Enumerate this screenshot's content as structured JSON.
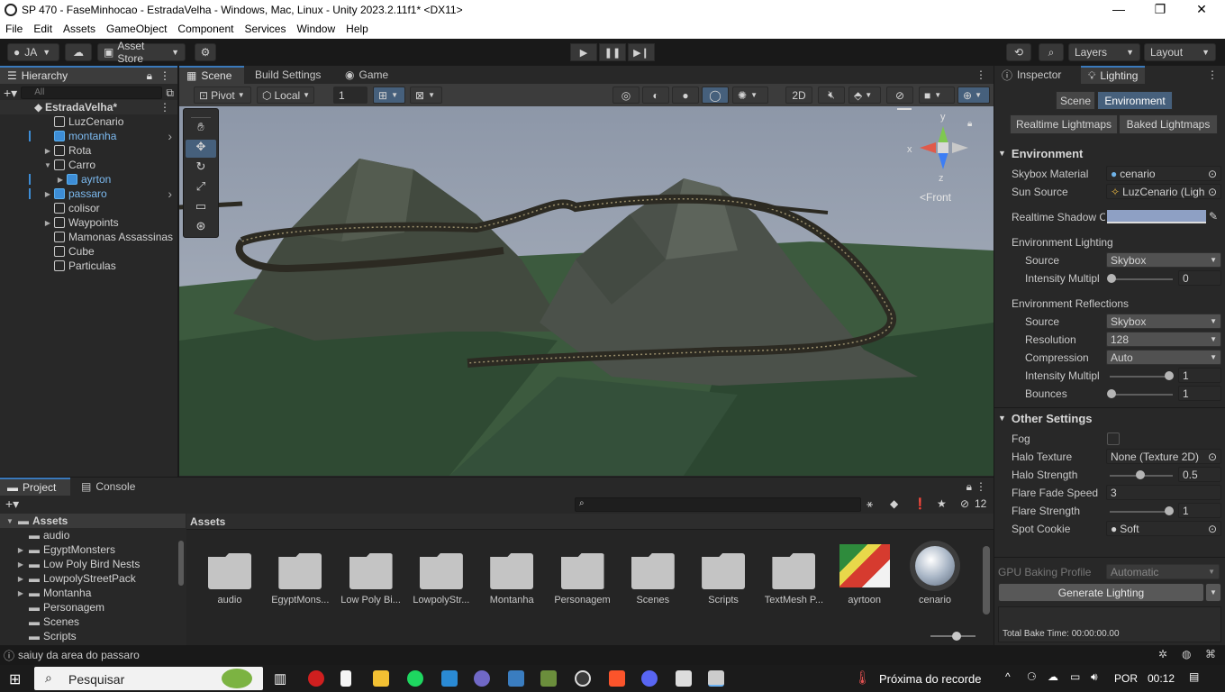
{
  "window": {
    "title": "SP 470 - FaseMinhocao - EstradaVelha - Windows, Mac, Linux - Unity 2023.2.11f1* <DX11>",
    "minimize": "—",
    "maximize": "❐",
    "close": "✕"
  },
  "menu": [
    "File",
    "Edit",
    "Assets",
    "GameObject",
    "Component",
    "Services",
    "Window",
    "Help"
  ],
  "toolbar": {
    "account": "JA",
    "asset_store": "Asset Store",
    "layers": "Layers",
    "layout": "Layout"
  },
  "hierarchy": {
    "tab": "Hierarchy",
    "search_placeholder": "All",
    "scene": "EstradaVelha*",
    "items": [
      {
        "label": "LuzCenario",
        "indent": 1,
        "arrow": "",
        "prefab": false
      },
      {
        "label": "montanha",
        "indent": 1,
        "arrow": "",
        "prefab": true
      },
      {
        "label": "Rota",
        "indent": 1,
        "arrow": "▶",
        "prefab": false
      },
      {
        "label": "Carro",
        "indent": 1,
        "arrow": "▼",
        "prefab": false
      },
      {
        "label": "ayrton",
        "indent": 2,
        "arrow": "▶",
        "prefab": true
      },
      {
        "label": "passaro",
        "indent": 1,
        "arrow": "▶",
        "prefab": true
      },
      {
        "label": "colisor",
        "indent": 1,
        "arrow": "",
        "prefab": false
      },
      {
        "label": "Waypoints",
        "indent": 1,
        "arrow": "▶",
        "prefab": false
      },
      {
        "label": "Mamonas Assassinas",
        "indent": 1,
        "arrow": "",
        "prefab": false
      },
      {
        "label": "Cube",
        "indent": 1,
        "arrow": "",
        "prefab": false
      },
      {
        "label": "Particulas",
        "indent": 1,
        "arrow": "",
        "prefab": false
      }
    ]
  },
  "scene_tabs": {
    "scene": "Scene",
    "build": "Build Settings",
    "game": "Game"
  },
  "scene_toolbar": {
    "pivot": "Pivot",
    "local": "Local",
    "grid_value": "1",
    "mode_2d": "2D"
  },
  "gizmo": {
    "front": "<Front",
    "y": "y",
    "x": "x",
    "z": "z"
  },
  "inspector": {
    "tab_inspector": "Inspector",
    "tab_lighting": "Lighting",
    "tab_scene": "Scene",
    "tab_environment": "Environment",
    "tab_realtime": "Realtime Lightmaps",
    "tab_baked": "Baked Lightmaps",
    "environment_header": "Environment",
    "skybox_material_label": "Skybox Material",
    "skybox_material_value": "cenario",
    "sun_source_label": "Sun Source",
    "sun_source_value": "LuzCenario (Ligh",
    "realtime_shadow_label": "Realtime Shadow C",
    "env_lighting_header": "Environment Lighting",
    "source_label": "Source",
    "source_value": "Skybox",
    "intensity_label": "Intensity Multipl",
    "intensity_value": "0",
    "env_reflections_header": "Environment Reflections",
    "ref_source_label": "Source",
    "ref_source_value": "Skybox",
    "resolution_label": "Resolution",
    "resolution_value": "128",
    "compression_label": "Compression",
    "compression_value": "Auto",
    "ref_intensity_label": "Intensity Multipl",
    "ref_intensity_value": "1",
    "bounces_label": "Bounces",
    "bounces_value": "1",
    "other_header": "Other Settings",
    "fog_label": "Fog",
    "halo_texture_label": "Halo Texture",
    "halo_texture_value": "None (Texture 2D)",
    "halo_strength_label": "Halo Strength",
    "halo_strength_value": "0.5",
    "flare_fade_label": "Flare Fade Speed",
    "flare_fade_value": "3",
    "flare_strength_label": "Flare Strength",
    "flare_strength_value": "1",
    "spot_cookie_label": "Spot Cookie",
    "spot_cookie_value": "Soft",
    "gpu_profile_label": "GPU Baking Profile",
    "gpu_profile_value": "Automatic",
    "generate": "Generate Lighting",
    "total_bake": "Total Bake Time: 00:00:00.00"
  },
  "project": {
    "tab_project": "Project",
    "tab_console": "Console",
    "hidden_count": "12",
    "assets_root": "Assets",
    "breadcrumb": "Assets",
    "tree": [
      "audio",
      "EgyptMonsters",
      "Low Poly Bird Nests",
      "LowpolyStreetPack",
      "Montanha",
      "Personagem",
      "Scenes",
      "Scripts"
    ],
    "tree_arrows": [
      "",
      "▶",
      "▶",
      "▶",
      "▶",
      "",
      "",
      ""
    ],
    "grid": [
      "audio",
      "EgyptMons...",
      "Low Poly Bi...",
      "LowpolyStr...",
      "Montanha",
      "Personagem",
      "Scenes",
      "Scripts",
      "TextMesh P...",
      "ayrtoon",
      "cenario"
    ]
  },
  "status": {
    "message": "saiuy da area do passaro"
  },
  "taskbar": {
    "search": "Pesquisar",
    "notification": "Próxima do recorde",
    "lang": "POR",
    "time": "00:12"
  }
}
